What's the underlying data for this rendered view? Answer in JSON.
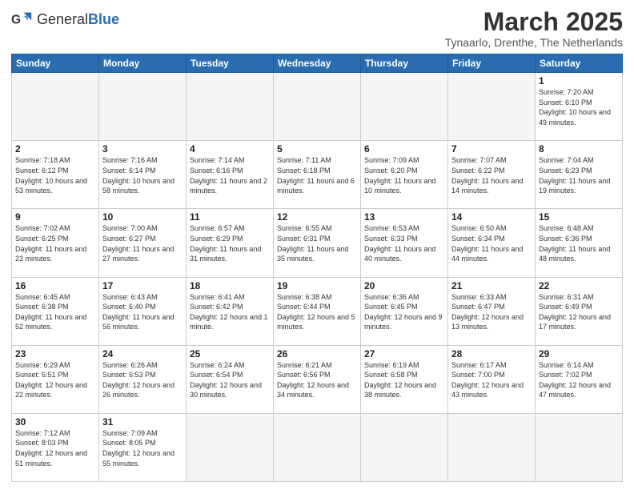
{
  "header": {
    "logo_general": "General",
    "logo_blue": "Blue",
    "month_title": "March 2025",
    "subtitle": "Tynaarlo, Drenthe, The Netherlands"
  },
  "weekdays": [
    "Sunday",
    "Monday",
    "Tuesday",
    "Wednesday",
    "Thursday",
    "Friday",
    "Saturday"
  ],
  "weeks": [
    [
      {
        "day": "",
        "info": ""
      },
      {
        "day": "",
        "info": ""
      },
      {
        "day": "",
        "info": ""
      },
      {
        "day": "",
        "info": ""
      },
      {
        "day": "",
        "info": ""
      },
      {
        "day": "",
        "info": ""
      },
      {
        "day": "1",
        "info": "Sunrise: 7:20 AM\nSunset: 6:10 PM\nDaylight: 10 hours and 49 minutes."
      }
    ],
    [
      {
        "day": "2",
        "info": "Sunrise: 7:18 AM\nSunset: 6:12 PM\nDaylight: 10 hours and 53 minutes."
      },
      {
        "day": "3",
        "info": "Sunrise: 7:16 AM\nSunset: 6:14 PM\nDaylight: 10 hours and 58 minutes."
      },
      {
        "day": "4",
        "info": "Sunrise: 7:14 AM\nSunset: 6:16 PM\nDaylight: 11 hours and 2 minutes."
      },
      {
        "day": "5",
        "info": "Sunrise: 7:11 AM\nSunset: 6:18 PM\nDaylight: 11 hours and 6 minutes."
      },
      {
        "day": "6",
        "info": "Sunrise: 7:09 AM\nSunset: 6:20 PM\nDaylight: 11 hours and 10 minutes."
      },
      {
        "day": "7",
        "info": "Sunrise: 7:07 AM\nSunset: 6:22 PM\nDaylight: 11 hours and 14 minutes."
      },
      {
        "day": "8",
        "info": "Sunrise: 7:04 AM\nSunset: 6:23 PM\nDaylight: 11 hours and 19 minutes."
      }
    ],
    [
      {
        "day": "9",
        "info": "Sunrise: 7:02 AM\nSunset: 6:25 PM\nDaylight: 11 hours and 23 minutes."
      },
      {
        "day": "10",
        "info": "Sunrise: 7:00 AM\nSunset: 6:27 PM\nDaylight: 11 hours and 27 minutes."
      },
      {
        "day": "11",
        "info": "Sunrise: 6:57 AM\nSunset: 6:29 PM\nDaylight: 11 hours and 31 minutes."
      },
      {
        "day": "12",
        "info": "Sunrise: 6:55 AM\nSunset: 6:31 PM\nDaylight: 11 hours and 35 minutes."
      },
      {
        "day": "13",
        "info": "Sunrise: 6:53 AM\nSunset: 6:33 PM\nDaylight: 11 hours and 40 minutes."
      },
      {
        "day": "14",
        "info": "Sunrise: 6:50 AM\nSunset: 6:34 PM\nDaylight: 11 hours and 44 minutes."
      },
      {
        "day": "15",
        "info": "Sunrise: 6:48 AM\nSunset: 6:36 PM\nDaylight: 11 hours and 48 minutes."
      }
    ],
    [
      {
        "day": "16",
        "info": "Sunrise: 6:45 AM\nSunset: 6:38 PM\nDaylight: 11 hours and 52 minutes."
      },
      {
        "day": "17",
        "info": "Sunrise: 6:43 AM\nSunset: 6:40 PM\nDaylight: 11 hours and 56 minutes."
      },
      {
        "day": "18",
        "info": "Sunrise: 6:41 AM\nSunset: 6:42 PM\nDaylight: 12 hours and 1 minute."
      },
      {
        "day": "19",
        "info": "Sunrise: 6:38 AM\nSunset: 6:44 PM\nDaylight: 12 hours and 5 minutes."
      },
      {
        "day": "20",
        "info": "Sunrise: 6:36 AM\nSunset: 6:45 PM\nDaylight: 12 hours and 9 minutes."
      },
      {
        "day": "21",
        "info": "Sunrise: 6:33 AM\nSunset: 6:47 PM\nDaylight: 12 hours and 13 minutes."
      },
      {
        "day": "22",
        "info": "Sunrise: 6:31 AM\nSunset: 6:49 PM\nDaylight: 12 hours and 17 minutes."
      }
    ],
    [
      {
        "day": "23",
        "info": "Sunrise: 6:29 AM\nSunset: 6:51 PM\nDaylight: 12 hours and 22 minutes."
      },
      {
        "day": "24",
        "info": "Sunrise: 6:26 AM\nSunset: 6:53 PM\nDaylight: 12 hours and 26 minutes."
      },
      {
        "day": "25",
        "info": "Sunrise: 6:24 AM\nSunset: 6:54 PM\nDaylight: 12 hours and 30 minutes."
      },
      {
        "day": "26",
        "info": "Sunrise: 6:21 AM\nSunset: 6:56 PM\nDaylight: 12 hours and 34 minutes."
      },
      {
        "day": "27",
        "info": "Sunrise: 6:19 AM\nSunset: 6:58 PM\nDaylight: 12 hours and 38 minutes."
      },
      {
        "day": "28",
        "info": "Sunrise: 6:17 AM\nSunset: 7:00 PM\nDaylight: 12 hours and 43 minutes."
      },
      {
        "day": "29",
        "info": "Sunrise: 6:14 AM\nSunset: 7:02 PM\nDaylight: 12 hours and 47 minutes."
      }
    ],
    [
      {
        "day": "30",
        "info": "Sunrise: 7:12 AM\nSunset: 8:03 PM\nDaylight: 12 hours and 51 minutes."
      },
      {
        "day": "31",
        "info": "Sunrise: 7:09 AM\nSunset: 8:05 PM\nDaylight: 12 hours and 55 minutes."
      },
      {
        "day": "",
        "info": ""
      },
      {
        "day": "",
        "info": ""
      },
      {
        "day": "",
        "info": ""
      },
      {
        "day": "",
        "info": ""
      },
      {
        "day": "",
        "info": ""
      }
    ]
  ]
}
